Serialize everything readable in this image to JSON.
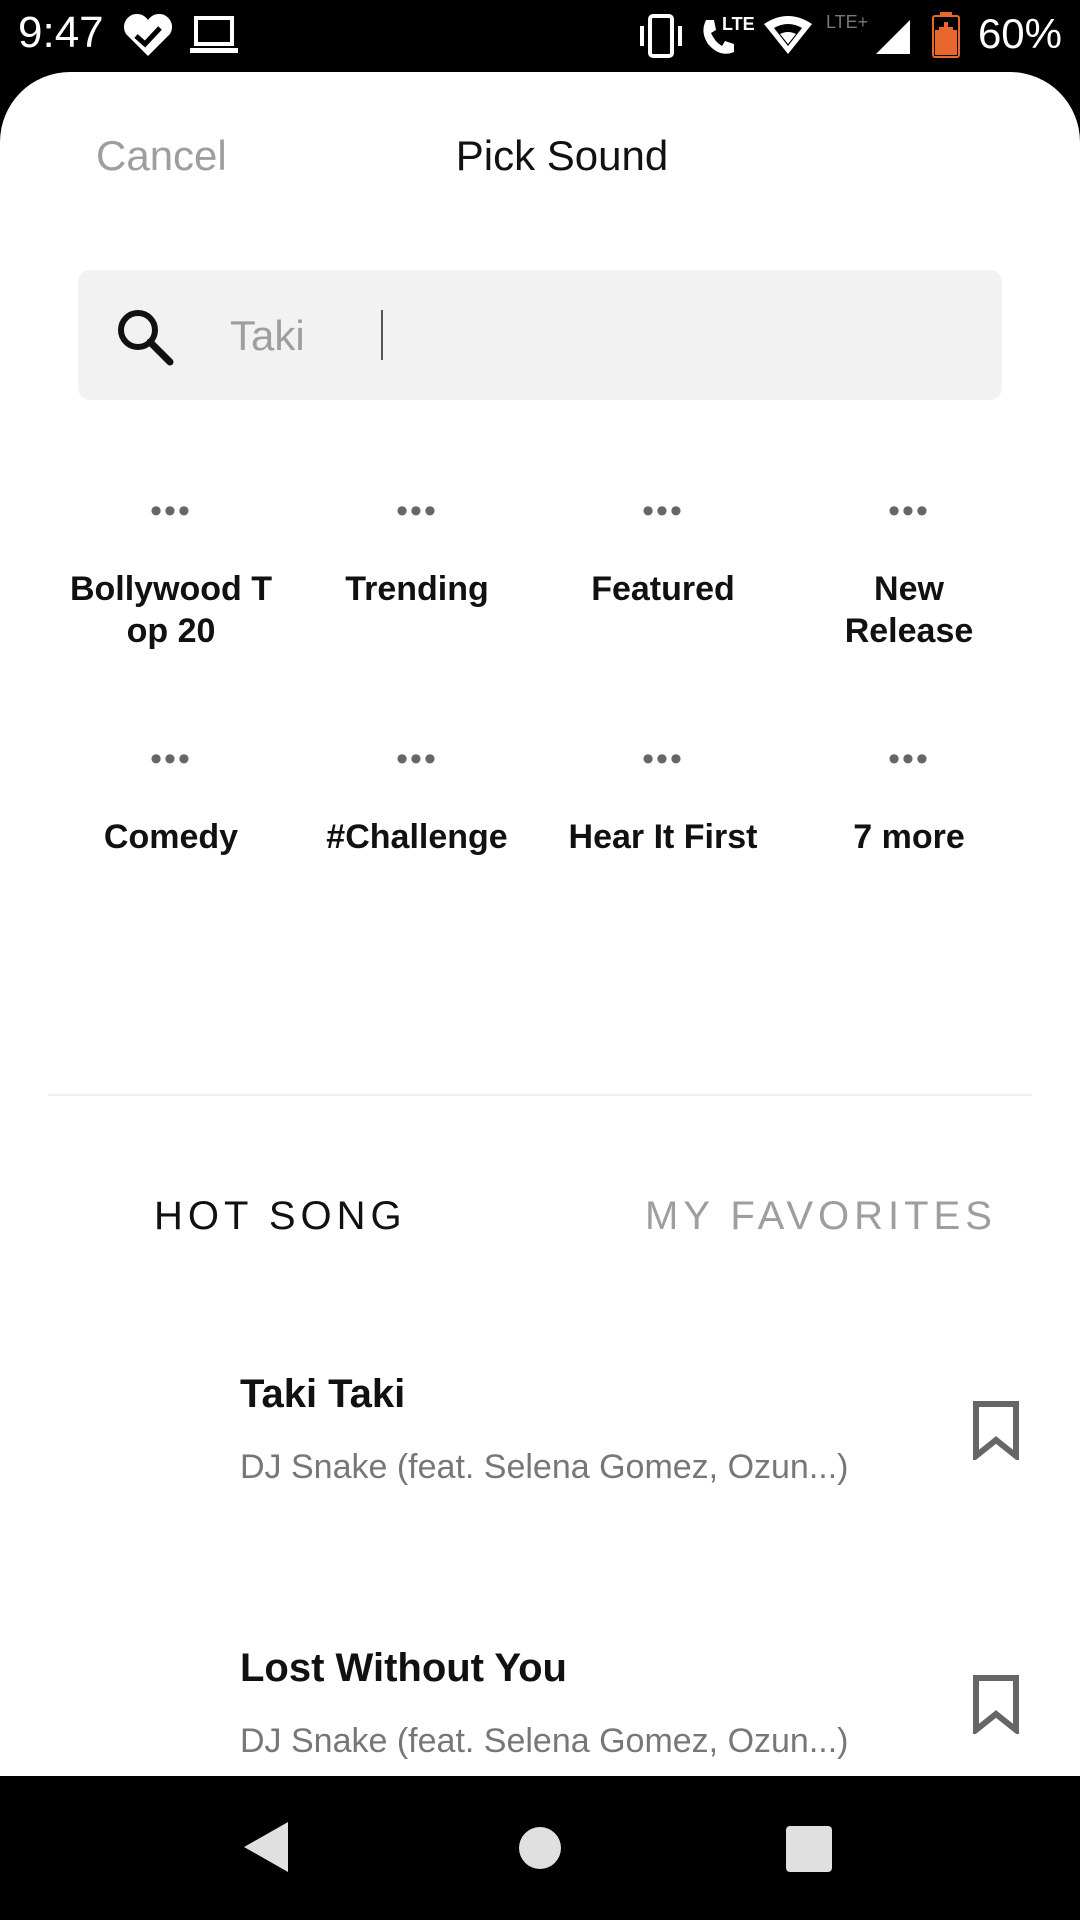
{
  "status_bar": {
    "time": "9:47",
    "battery_percent": "60%",
    "icons": [
      "heart-check-icon",
      "laptop-icon",
      "vibrate-icon",
      "lte-call-icon",
      "wifi-icon",
      "lte-plus-icon",
      "signal-icon",
      "battery-icon"
    ],
    "network_labels": {
      "call": "LTE",
      "data": "LTE+"
    }
  },
  "header": {
    "cancel_label": "Cancel",
    "title": "Pick Sound"
  },
  "search": {
    "value": "Taki",
    "icon": "search-icon"
  },
  "categories": [
    {
      "label": "Bollywood Top 20"
    },
    {
      "label": "Trending"
    },
    {
      "label": "Featured"
    },
    {
      "label": "New Release"
    },
    {
      "label": "Comedy"
    },
    {
      "label": "#Challenge"
    },
    {
      "label": "Hear It First"
    },
    {
      "label": "7 more"
    }
  ],
  "category_icon": "•••",
  "tabs": [
    {
      "label": "HOT SONG",
      "active": true
    },
    {
      "label": "MY FAVORITES",
      "active": false
    }
  ],
  "songs": [
    {
      "title": "Taki Taki",
      "artist": "DJ Snake (feat. Selena Gomez, Ozun...)"
    },
    {
      "title": "Lost Without You",
      "artist": "DJ Snake (feat. Selena Gomez, Ozun...)"
    }
  ],
  "navigation": {
    "back": "back-icon",
    "home": "home-icon",
    "recents": "recents-icon"
  },
  "colors": {
    "text_primary": "#111111",
    "text_muted": "#9e9e9e",
    "search_bg": "#f2f2f2",
    "battery_accent": "#e8672d"
  }
}
